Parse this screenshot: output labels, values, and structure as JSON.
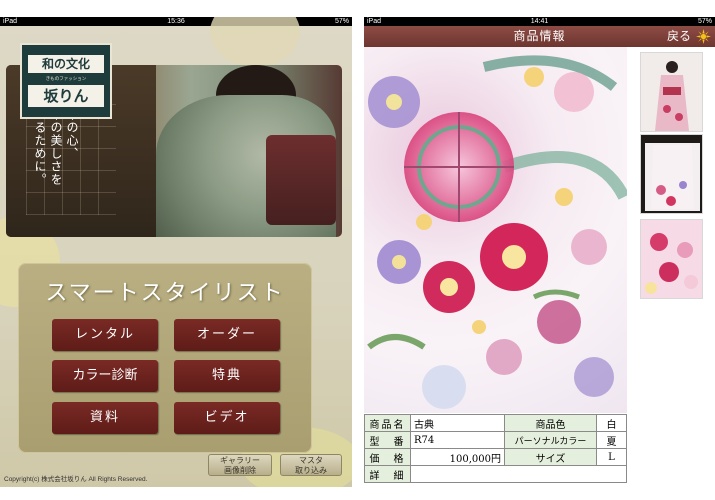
{
  "left_screen": {
    "status": {
      "carrier": "iPad",
      "time": "15:36",
      "battery": "57%"
    },
    "logo": {
      "line1": "和の文化",
      "line2": "きものファッション",
      "line3": "坂りん"
    },
    "tagline": [
      "日本の心、",
      "日本の美しさを",
      "伝えるために。"
    ],
    "panel_title": "スマートスタイリスト",
    "menu": {
      "rental": "レンタル",
      "order": "オーダー",
      "color_diagnosis": "カラー診断",
      "benefits": "特典",
      "materials": "資料",
      "video": "ビデオ"
    },
    "footer": {
      "copyright": "Copyright(c) 株式会社坂りん All Rights Reserved.",
      "gallery_delete_line1": "ギャラリー",
      "gallery_delete_line2": "画像削除",
      "master_fetch_line1": "マスタ",
      "master_fetch_line2": "取り込み"
    }
  },
  "right_screen": {
    "status": {
      "carrier": "iPad",
      "time": "14:41",
      "battery": "57%"
    },
    "nav_title": "商品情報",
    "back_label": "戻る",
    "icons": {
      "back": "sun-flower-icon",
      "thumbs": [
        "kimono-full-icon",
        "kimono-front-icon",
        "kimono-pattern-icon"
      ]
    },
    "product": {
      "name_label": "商品名",
      "name_value": "古典",
      "color_label": "商品色",
      "color_value": "白",
      "model_label": "型　番",
      "model_value": "R74",
      "personal_color_label": "パーソナルカラー",
      "personal_color_value": "夏",
      "price_label": "価　格",
      "price_value": "100,000円",
      "size_label": "サイズ",
      "size_value": "L",
      "detail_label": "詳　細",
      "detail_value": ""
    }
  },
  "colors": {
    "button_maroon": "#6c2420",
    "nav_brown": "#7d3f38",
    "table_label_bg": "#e5efdd",
    "logo_green": "#1f3c3c"
  }
}
